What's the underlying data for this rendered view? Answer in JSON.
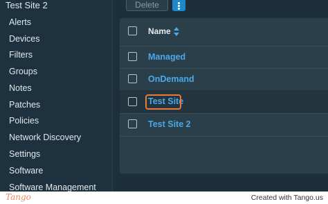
{
  "sidebar": {
    "site_title": "Test Site 2",
    "items": [
      "Alerts",
      "Devices",
      "Filters",
      "Groups",
      "Notes",
      "Patches",
      "Policies",
      "Network Discovery",
      "Settings",
      "Software",
      "Software Management"
    ]
  },
  "toolbar": {
    "delete_label": "Delete",
    "more_icon": "kebab-vertical-icon"
  },
  "table": {
    "column_header": "Name",
    "rows": [
      "Managed",
      "OnDemand",
      "Test Site",
      "Test Site 2"
    ],
    "highlighted_row": "Test Site"
  },
  "colors": {
    "accent": "#1e88c9",
    "link": "#4aa9e6",
    "highlight": "#ea7a3a",
    "background": "#1c2f3b"
  },
  "footer": {
    "logo": "Tango",
    "credit": "Created with Tango.us"
  }
}
